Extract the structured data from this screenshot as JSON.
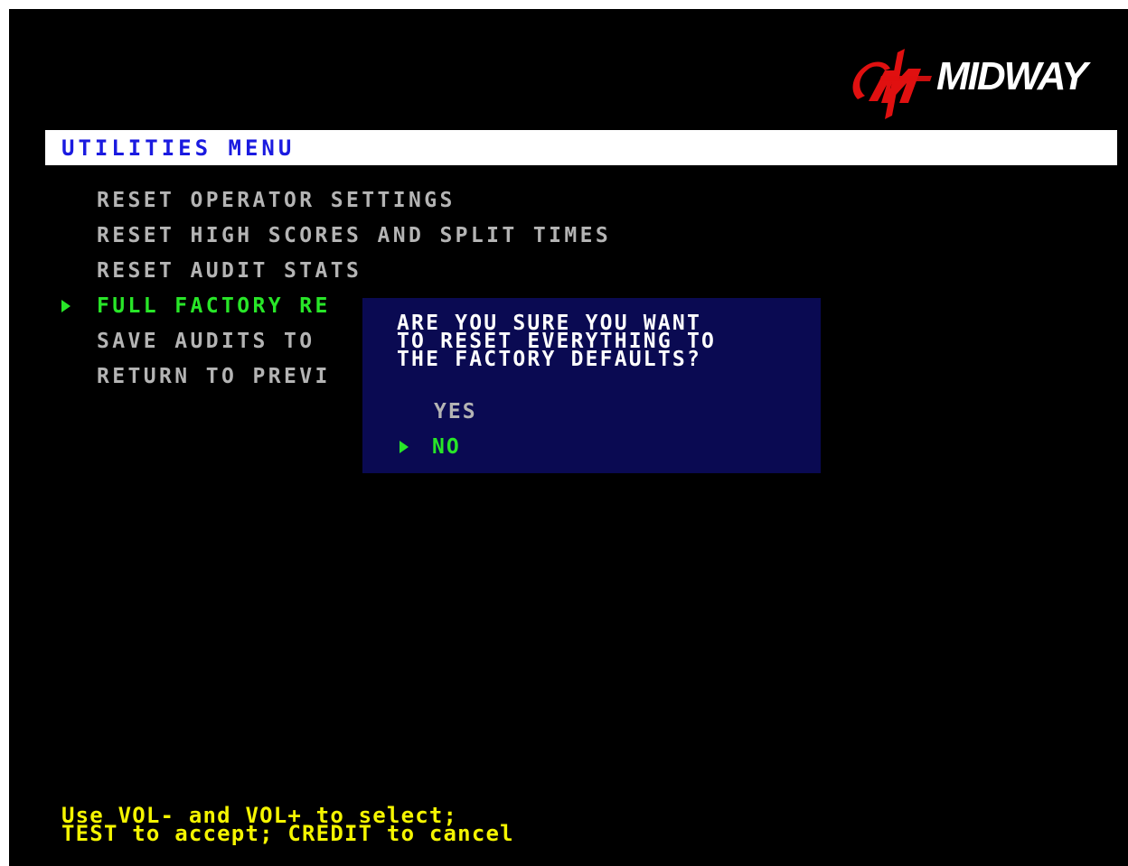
{
  "brand": {
    "logo_text": "MIDWAY",
    "logo_color": "#e01010"
  },
  "header": {
    "title": "UTILITIES MENU"
  },
  "menu": {
    "items": [
      {
        "label": "RESET OPERATOR SETTINGS",
        "selected": false
      },
      {
        "label": "RESET HIGH SCORES AND SPLIT TIMES",
        "selected": false
      },
      {
        "label": "RESET AUDIT STATS",
        "selected": false
      },
      {
        "label": "FULL FACTORY RE",
        "selected": true
      },
      {
        "label": "SAVE AUDITS TO",
        "selected": false
      },
      {
        "label": "RETURN TO PREVI",
        "selected": false
      }
    ],
    "cursor_icon": "triangle-right-icon"
  },
  "dialog": {
    "lines": [
      "ARE YOU SURE YOU WANT",
      "TO RESET EVERYTHING TO",
      "THE FACTORY DEFAULTS?"
    ],
    "options": [
      {
        "label": "YES",
        "selected": false
      },
      {
        "label": "NO",
        "selected": true
      }
    ]
  },
  "footer": {
    "lines": [
      "Use VOL- and VOL+ to select;",
      "TEST to accept; CREDIT to cancel"
    ]
  },
  "colors": {
    "background": "#000000",
    "menu_text": "#b4b4b4",
    "selected_text": "#28e628",
    "dialog_bg": "#0a0a52",
    "title_text": "#1a1ae0",
    "footer_text": "#f5f500"
  }
}
